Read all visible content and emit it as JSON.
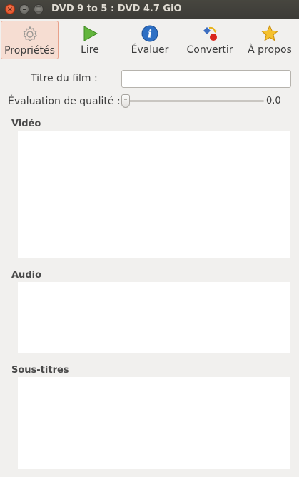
{
  "window": {
    "title": "DVD 9 to 5 : DVD 4.7 GiO",
    "controls": {
      "close": "×",
      "minimize": "–",
      "maximize": "□"
    }
  },
  "toolbar": {
    "items": [
      {
        "label": "Propriétés",
        "icon": "gear-icon",
        "active": true
      },
      {
        "label": "Lire",
        "icon": "play-icon",
        "active": false
      },
      {
        "label": "Évaluer",
        "icon": "info-icon",
        "active": false
      },
      {
        "label": "Convertir",
        "icon": "convert-icon",
        "active": false
      },
      {
        "label": "À propos",
        "icon": "star-icon",
        "active": false
      }
    ]
  },
  "form": {
    "title_label": "Titre du film :",
    "title_value": "",
    "quality_label": "Évaluation de qualité :",
    "quality_value": "0.0"
  },
  "sections": {
    "video": "Vidéo",
    "audio": "Audio",
    "subtitles": "Sous-titres"
  },
  "colors": {
    "active_button_bg": "#f6ddd2",
    "active_button_border": "#e8a08a",
    "titlebar": "#3c3b37",
    "close_button": "#e0461b"
  }
}
